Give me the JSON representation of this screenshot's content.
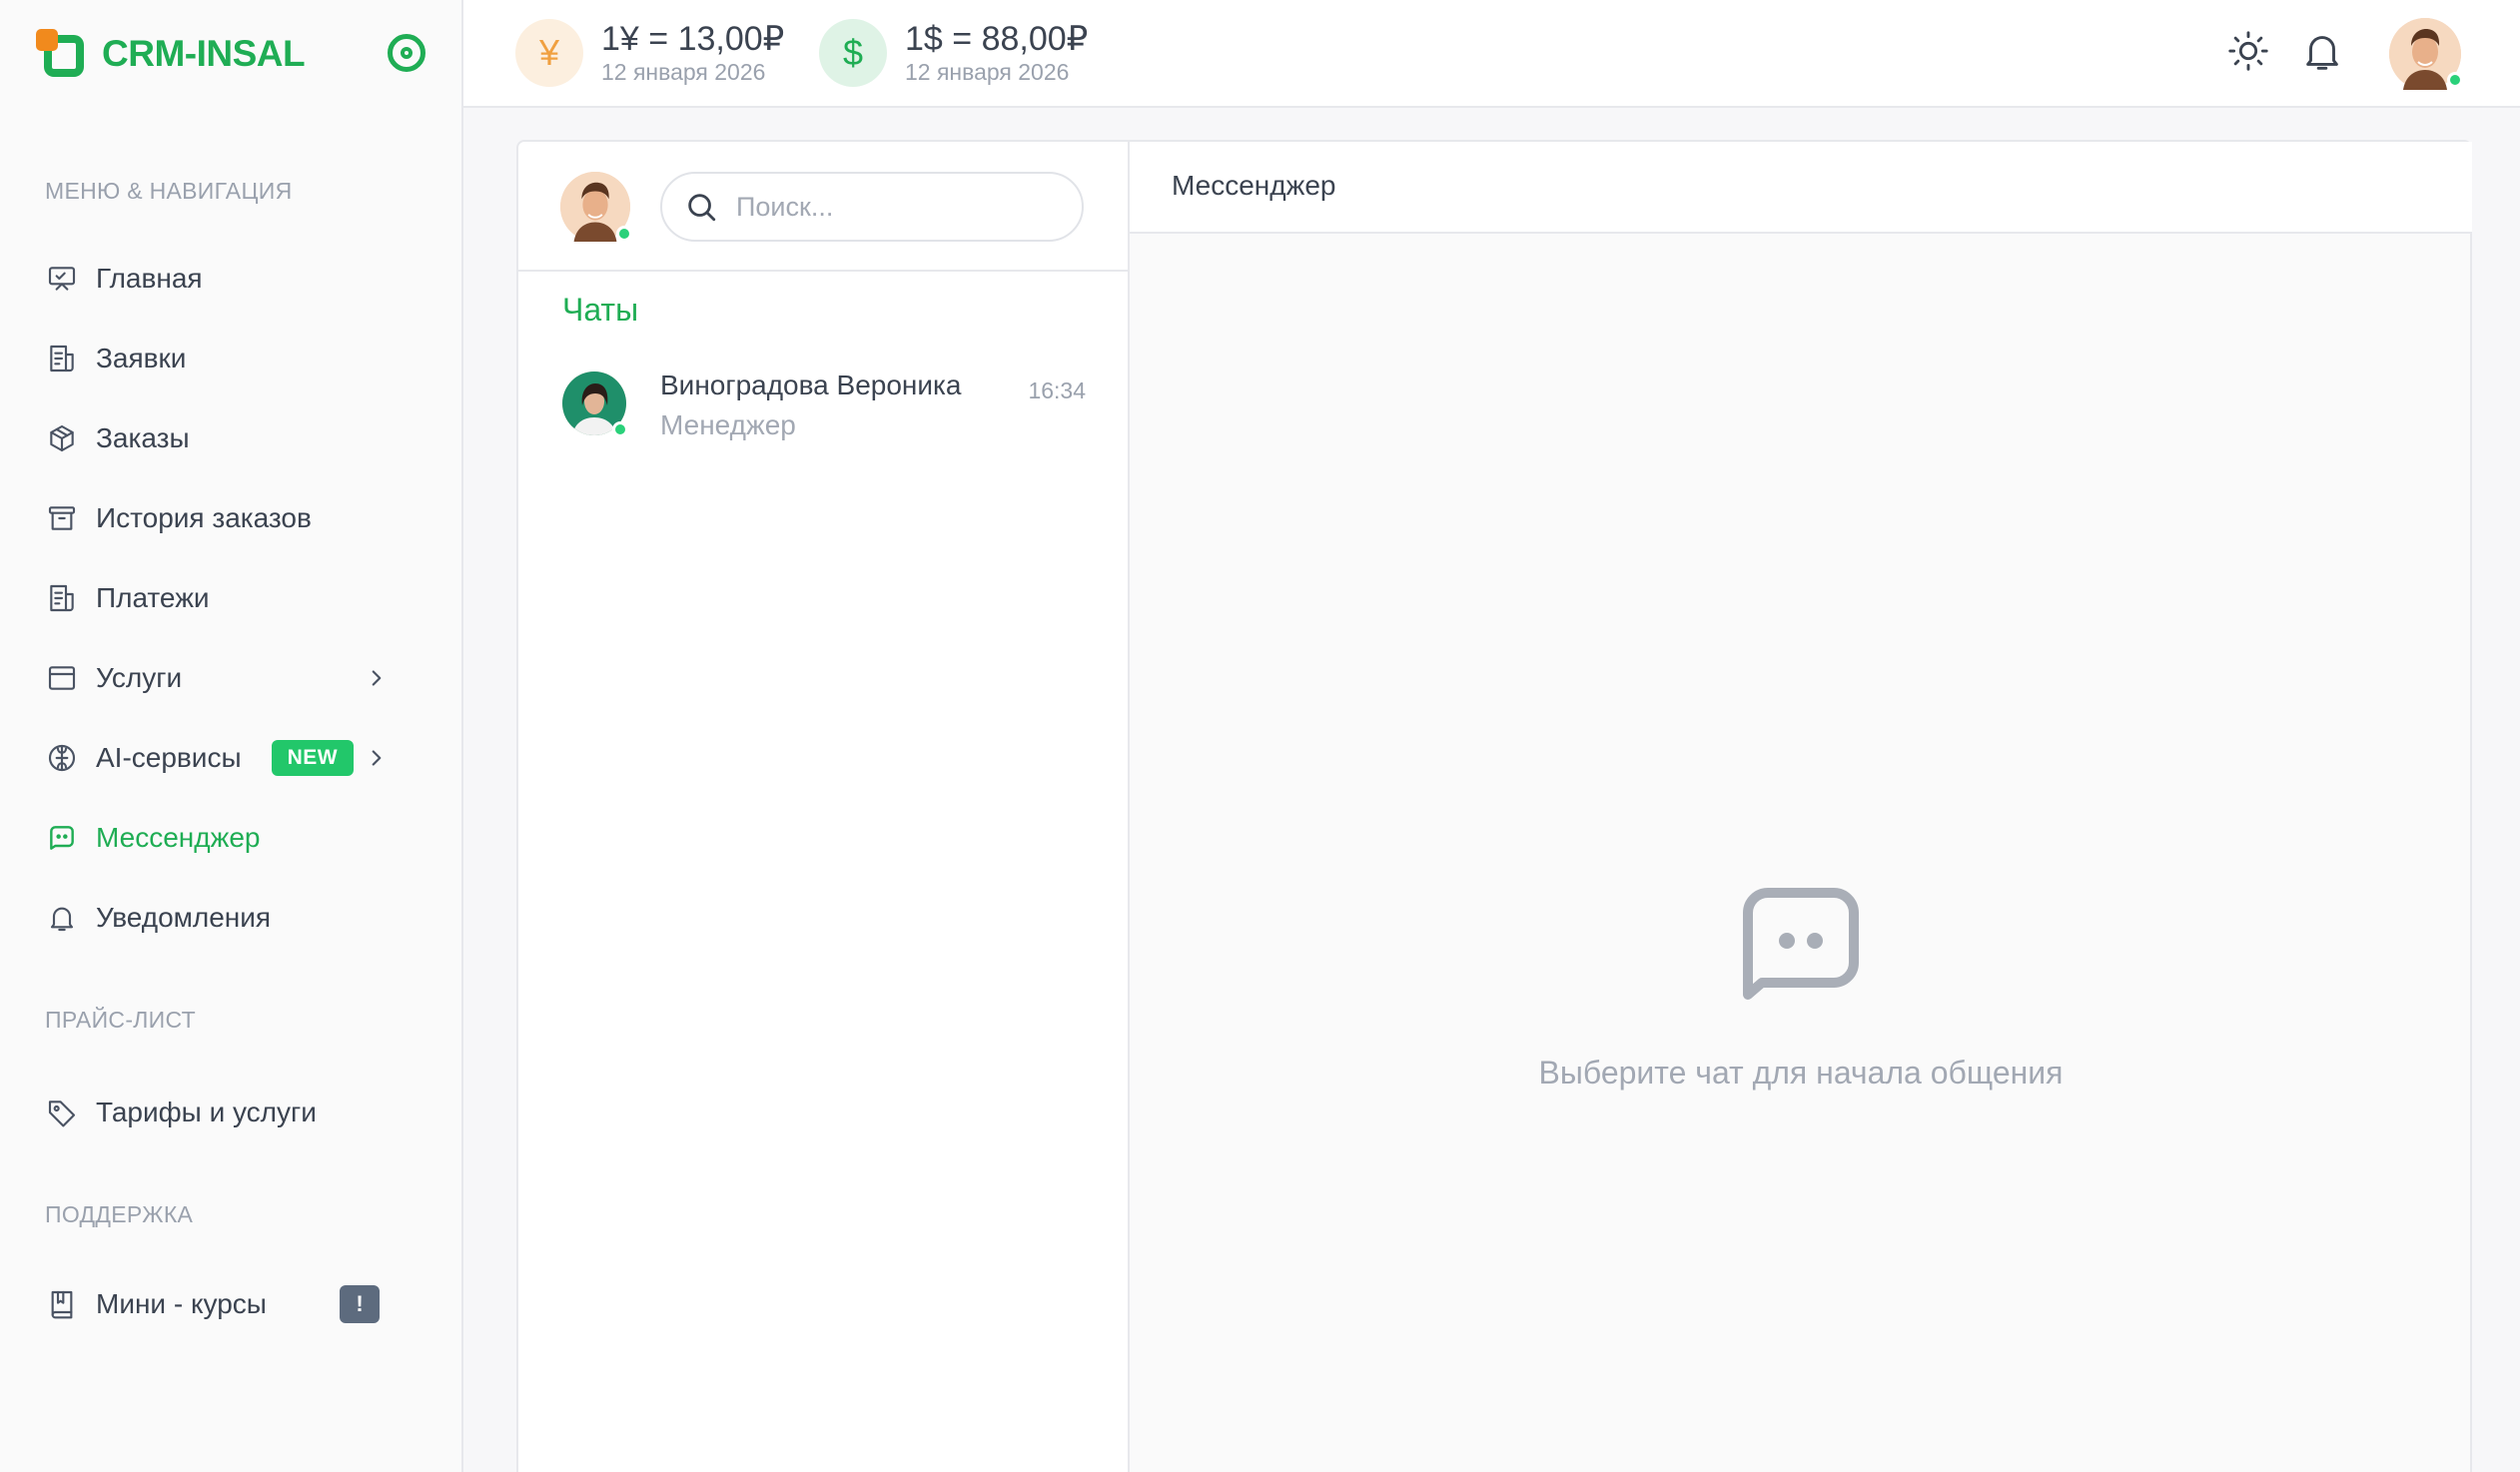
{
  "brand": {
    "name": "CRM-INSAL"
  },
  "colors": {
    "accent": "#1fad54",
    "brand_orange": "#f18a1d",
    "online": "#2ad17a",
    "new_badge": "#22c76a"
  },
  "sidebar": {
    "sections": [
      {
        "title": "МЕНЮ & НАВИГАЦИЯ"
      },
      {
        "title": "ПРАЙС-ЛИСТ"
      },
      {
        "title": "ПОДДЕРЖКА"
      }
    ],
    "items": [
      {
        "label": "Главная",
        "icon": "presentation-icon"
      },
      {
        "label": "Заявки",
        "icon": "receipt-icon"
      },
      {
        "label": "Заказы",
        "icon": "box-icon"
      },
      {
        "label": "История заказов",
        "icon": "archive-icon"
      },
      {
        "label": "Платежи",
        "icon": "receipt-icon"
      },
      {
        "label": "Услуги",
        "icon": "window-icon",
        "has_submenu": true
      },
      {
        "label": "AI-сервисы",
        "icon": "brain-icon",
        "badge": "NEW",
        "has_submenu": true
      },
      {
        "label": "Мессенджер",
        "icon": "chat-icon",
        "active": true
      },
      {
        "label": "Уведомления",
        "icon": "bell-icon"
      },
      {
        "label": "Тарифы и услуги",
        "icon": "tag-icon"
      },
      {
        "label": "Мини - курсы",
        "icon": "book-icon",
        "badge": "!"
      }
    ]
  },
  "header": {
    "rates": [
      {
        "symbol": "¥",
        "value": "1¥ = 13,00₽",
        "date": "12 января 2026",
        "icon": "yen-icon"
      },
      {
        "symbol": "$",
        "value": "1$ = 88,00₽",
        "date": "12 января 2026",
        "icon": "dollar-icon"
      }
    ]
  },
  "chat_list": {
    "search_placeholder": "Поиск...",
    "title": "Чаты",
    "chats": [
      {
        "name": "Виноградова Вероника",
        "role": "Менеджер",
        "time": "16:34",
        "online": true
      }
    ]
  },
  "messenger": {
    "title": "Мессенджер",
    "empty_text": "Выберите чат для начала общения"
  }
}
